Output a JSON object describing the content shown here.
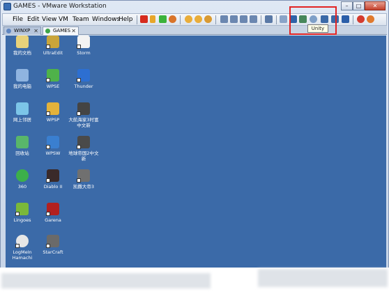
{
  "window": {
    "title": "GAMES - VMware Workstation"
  },
  "menu": [
    "File",
    "Edit",
    "View",
    "VM",
    "Team",
    "Windows",
    "Help"
  ],
  "tooltip": "Unity",
  "tabs": [
    {
      "label": "WINXP",
      "active": false
    },
    {
      "label": "GAMES",
      "active": true
    }
  ],
  "desktop_icons": [
    {
      "label": "我的文档",
      "icon": "my-documents-icon",
      "color": "#e8d27a"
    },
    {
      "label": "UltraEdit",
      "icon": "ultraedit-icon",
      "color": "#c9a53a"
    },
    {
      "label": "Storm",
      "icon": "storm-icon",
      "color": "#f3f3f3"
    },
    {
      "label": "我的电脑",
      "icon": "my-computer-icon",
      "color": "#8fb4e0"
    },
    {
      "label": "WPSE",
      "icon": "wpse-icon",
      "color": "#4fb24a"
    },
    {
      "label": "Thunder",
      "icon": "thunder-icon",
      "color": "#2d6fd1"
    },
    {
      "label": "网上邻居",
      "icon": "network-icon",
      "color": "#7cc5e8"
    },
    {
      "label": "WPSP",
      "icon": "wpsp-icon",
      "color": "#e3b23b"
    },
    {
      "label": "大航海家3时富中文新",
      "icon": "game-icon",
      "color": "#444444"
    },
    {
      "label": "回收站",
      "icon": "recycle-bin-icon",
      "color": "#59b66a"
    },
    {
      "label": "WPSW",
      "icon": "wpsw-icon",
      "color": "#3a7fd0"
    },
    {
      "label": "地球帝国2中文新",
      "icon": "game-icon",
      "color": "#4a4a4a"
    },
    {
      "label": "360",
      "icon": "360-icon",
      "color": "#3cb04a"
    },
    {
      "label": "Diablo II",
      "icon": "diablo-icon",
      "color": "#3a2a2a"
    },
    {
      "label": "凯撒大帝3",
      "icon": "game-icon",
      "color": "#707070"
    },
    {
      "label": "Lingoes",
      "icon": "lingoes-icon",
      "color": "#7ab83a"
    },
    {
      "label": "Garena",
      "icon": "garena-icon",
      "color": "#b22020"
    },
    {
      "label": "LogMeIn Hamachi",
      "icon": "hamachi-icon",
      "color": "#e6e6e6"
    },
    {
      "label": "StarCraft",
      "icon": "starcraft-icon",
      "color": "#6a6a6a"
    }
  ],
  "colors": {
    "desktop": "#3b6aa8",
    "highlight": "#e22323"
  }
}
